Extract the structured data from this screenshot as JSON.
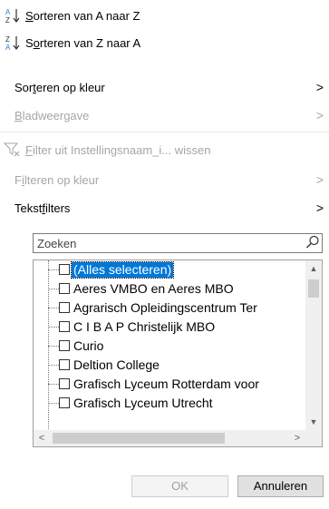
{
  "menu": {
    "sort_az": {
      "label_prefix": "S",
      "label_rest": "orteren van A naar Z",
      "icon": "sort-ascending-icon"
    },
    "sort_za": {
      "label_prefix": "S",
      "label_u": "o",
      "label_rest": "rteren van Z naar A",
      "icon": "sort-descending-icon"
    },
    "sort_color": {
      "label_a": "Sor",
      "label_u": "t",
      "label_b": "eren op kleur"
    },
    "sheet_view": {
      "label_u": "B",
      "label_rest": "ladweergave"
    },
    "clear_filter": {
      "label_u": "F",
      "label_rest": "ilter uit Instellingsnaam_i... wissen",
      "icon": "clear-filter-icon"
    },
    "filter_color": {
      "label_a": "F",
      "label_u": "i",
      "label_b": "lteren op kleur"
    },
    "text_filters": {
      "label_a": "Tekst",
      "label_u": "f",
      "label_b": "ilters"
    },
    "arrow": ">"
  },
  "search": {
    "placeholder": "Zoeken"
  },
  "list": {
    "items": [
      {
        "label": "(Alles selecteren)",
        "checked": false,
        "selected": true
      },
      {
        "label": "Aeres VMBO en Aeres MBO",
        "checked": false
      },
      {
        "label": "Agrarisch Opleidingscentrum Ter",
        "checked": false
      },
      {
        "label": "C I B A P Christelijk MBO",
        "checked": false
      },
      {
        "label": "Curio",
        "checked": false
      },
      {
        "label": "Deltion College",
        "checked": false
      },
      {
        "label": "Grafisch Lyceum Rotterdam voor",
        "checked": false
      },
      {
        "label": "Grafisch Lyceum Utrecht",
        "checked": false
      }
    ]
  },
  "buttons": {
    "ok": "OK",
    "cancel": "Annuleren"
  }
}
